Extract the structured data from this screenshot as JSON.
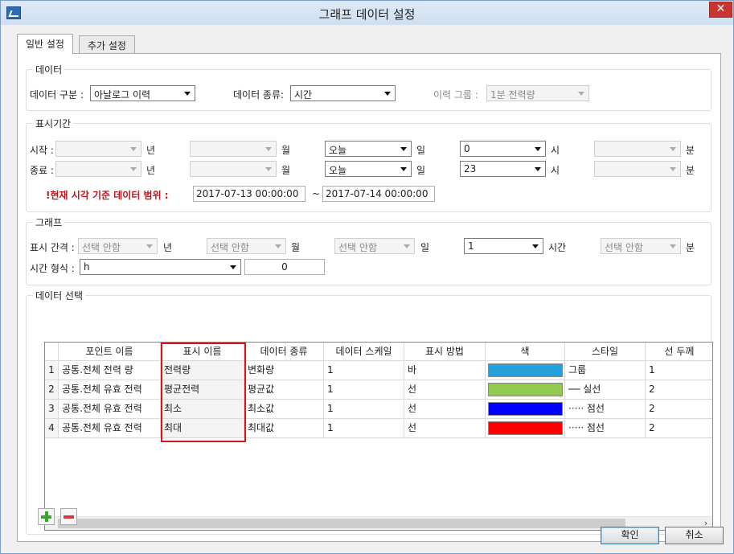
{
  "window": {
    "title": "그래프 데이터 설정",
    "close_glyph": "✕"
  },
  "tabs": [
    {
      "label": "일반 설정"
    },
    {
      "label": "추가 설정"
    }
  ],
  "data_group": {
    "title": "데이터",
    "category_label": "데이터 구분 :",
    "category_value": "아날로그 이력",
    "type_label": "데이터 종류:",
    "type_value": "시간",
    "history_group_label": "이력 그룹 :",
    "history_group_value": "1분 전력량"
  },
  "period_group": {
    "title": "표시기간",
    "start_label": "시작 :",
    "end_label": "종료 :",
    "unit_year": "년",
    "unit_month": "월",
    "unit_day": "일",
    "unit_hour": "시",
    "unit_minute": "분",
    "start_day": "오늘",
    "start_hour": "0",
    "end_day": "오늘",
    "end_hour": "23",
    "range_label": "!현재 시각 기준 데이터 범위 :",
    "range_from": "2017-07-13 00:00:00",
    "range_tilde": "~",
    "range_to": "2017-07-14 00:00:00"
  },
  "graph_group": {
    "title": "그래프",
    "interval_label": "표시 간격 :",
    "unselected": "선택 안함",
    "unit_year": "년",
    "unit_month": "월",
    "unit_day": "일",
    "unit_hour": "시간",
    "unit_minute": "분",
    "hour_value": "1",
    "time_format_label": "시간 형식 :",
    "time_format_value": "h",
    "time_format_number": "0"
  },
  "selection_group": {
    "title": "데이터 선택",
    "columns": [
      "포인트 이름",
      "표시 이름",
      "데이터 종류",
      "데이터 스케일",
      "표시 방법",
      "색",
      "스타일",
      "선 두께"
    ],
    "rows": [
      {
        "num": "1",
        "point": "공통.전체 전력 량",
        "display": "전력량",
        "kind": "변화량",
        "scale": "1",
        "method": "바",
        "color": "#26a0da",
        "style": "그룹",
        "width": "1"
      },
      {
        "num": "2",
        "point": "공통.전체 유효 전력",
        "display": "평균전력",
        "kind": "평균값",
        "scale": "1",
        "method": "선",
        "color": "#92c94f",
        "style": "── 실선",
        "width": "2"
      },
      {
        "num": "3",
        "point": "공통.전체 유효 전력",
        "display": "최소",
        "kind": "최소값",
        "scale": "1",
        "method": "선",
        "color": "#0000ff",
        "style": "····· 점선",
        "width": "2"
      },
      {
        "num": "4",
        "point": "공통.전체 유효 전력",
        "display": "최대",
        "kind": "최대값",
        "scale": "1",
        "method": "선",
        "color": "#ff0000",
        "style": "····· 점선",
        "width": "2"
      }
    ],
    "scroll_left": "‹",
    "scroll_right": "›"
  },
  "buttons": {
    "ok": "확인",
    "cancel": "취소"
  }
}
